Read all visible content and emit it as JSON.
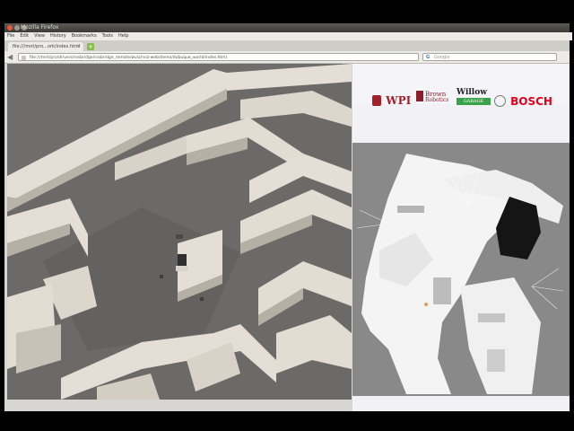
{
  "window": {
    "title": "Mozilla Firefox",
    "menu": [
      "File",
      "Edit",
      "View",
      "History",
      "Bookmarks",
      "Tools",
      "Help"
    ]
  },
  "tab": {
    "label": "file:///mnt/pro...ork/index.html",
    "close": "×",
    "new_tab": "+"
  },
  "nav": {
    "back": "◀",
    "url": "file:///mnt/pro/drivers/rosbridge/rosbridge_remote/wviz/rviz-web/demo/dubuque_world/index.html",
    "search_placeholder": "Google",
    "search_engine_icon": "G"
  },
  "logos": {
    "wpi": "WPI",
    "brown_line1": "Brown",
    "brown_line2": "Robotics",
    "willow": "Willow",
    "willow_sub": "GARAGE",
    "bosch": "BOSCH"
  },
  "colors": {
    "wpi_red": "#a31f2a",
    "brown_red": "#8b1e2a",
    "willow_green": "#3aa34a",
    "bosch_red": "#e2001a",
    "floor": "#6d6c6a",
    "wall_top": "#e6e0d8",
    "wall_side": "#bfb8ae"
  }
}
